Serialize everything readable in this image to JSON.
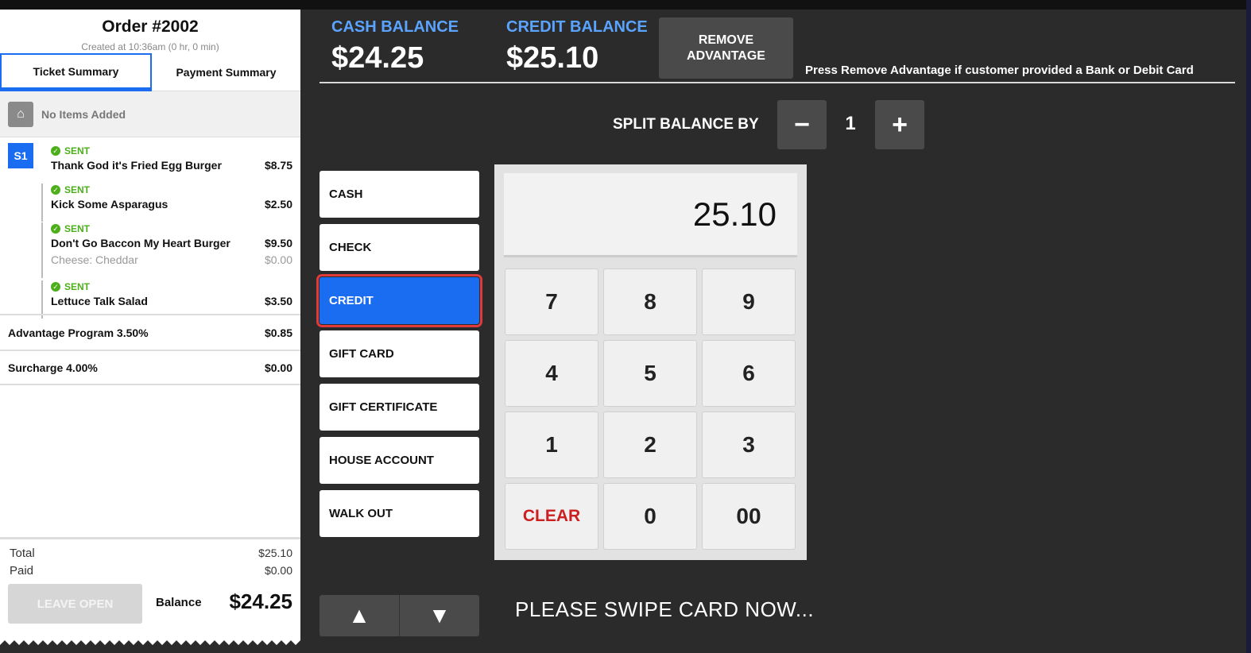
{
  "ticket": {
    "title": "Order #2002",
    "created": "Created at 10:36am (0 hr, 0 min)",
    "tabs": [
      "Ticket Summary",
      "Payment Summary"
    ],
    "no_items": "No Items Added",
    "seat": "S1",
    "items": [
      {
        "status": "SENT",
        "name": "Thank God it's Fried Egg Burger",
        "price": "$8.75"
      },
      {
        "status": "SENT",
        "name": "Kick Some Asparagus",
        "price": "$2.50"
      },
      {
        "status": "SENT",
        "name": "Don't Go Baccon My Heart Burger",
        "price": "$9.50",
        "modifier": "Cheese: Cheddar",
        "modifier_price": "$0.00"
      },
      {
        "status": "SENT",
        "name": "Lettuce Talk Salad",
        "price": "$3.50"
      }
    ],
    "fees": [
      {
        "label": "Advantage Program 3.50%",
        "value": "$0.85"
      },
      {
        "label": "Surcharge 4.00%",
        "value": "$0.00"
      }
    ],
    "total_label": "Total",
    "total_value": "$25.10",
    "paid_label": "Paid",
    "paid_value": "$0.00",
    "leave_open": "LEAVE OPEN",
    "balance_label": "Balance",
    "balance_value": "$24.25"
  },
  "header": {
    "cash_label": "CASH BALANCE",
    "cash_value": "$24.25",
    "credit_label": "CREDIT BALANCE",
    "credit_value": "$25.10",
    "remove_line1": "REMOVE",
    "remove_line2": "ADVANTAGE",
    "remove_note": "Press Remove Advantage if customer provided a Bank or Debit Card"
  },
  "split": {
    "label": "SPLIT BALANCE BY",
    "minus": "−",
    "value": "1",
    "plus": "+"
  },
  "payment_types": [
    "CASH",
    "CHECK",
    "CREDIT",
    "GIFT CARD",
    "GIFT CERTIFICATE",
    "HOUSE ACCOUNT",
    "WALK OUT"
  ],
  "selected_payment": "CREDIT",
  "keypad": {
    "display": "25.10",
    "keys": [
      "7",
      "8",
      "9",
      "4",
      "5",
      "6",
      "1",
      "2",
      "3",
      "CLEAR",
      "0",
      "00"
    ]
  },
  "arrows": {
    "up": "▲",
    "down": "▼"
  },
  "swipe_message": "PLEASE SWIPE CARD NOW...",
  "colors": {
    "accent": "#1a6cf0",
    "balance_label": "#5aa4ff",
    "sent": "#4caf1a",
    "clear": "#cc1f1f"
  }
}
